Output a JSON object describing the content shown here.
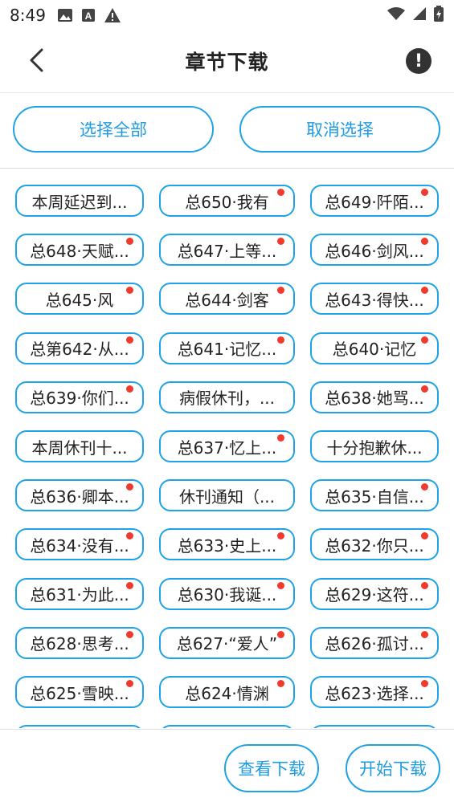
{
  "status_bar": {
    "time": "8:49"
  },
  "header": {
    "title": "章节下载"
  },
  "actions": {
    "select_all": "选择全部",
    "cancel_select": "取消选择"
  },
  "chapters": [
    {
      "label": "本周延迟到...",
      "new": false
    },
    {
      "label": "总650·我有",
      "new": true
    },
    {
      "label": "总649·阡陌...",
      "new": true
    },
    {
      "label": "总648·天赋...",
      "new": true
    },
    {
      "label": "总647·上等...",
      "new": true
    },
    {
      "label": "总646·剑风...",
      "new": true
    },
    {
      "label": "总645·风",
      "new": true
    },
    {
      "label": "总644·剑客",
      "new": true
    },
    {
      "label": "总643·得快...",
      "new": true
    },
    {
      "label": "总第642·从...",
      "new": true
    },
    {
      "label": "总641·记忆...",
      "new": true
    },
    {
      "label": "总640·记忆",
      "new": true
    },
    {
      "label": "总639·你们...",
      "new": true
    },
    {
      "label": "病假休刊，...",
      "new": false
    },
    {
      "label": "总638·她骂...",
      "new": true
    },
    {
      "label": "本周休刊十...",
      "new": false
    },
    {
      "label": "总637·忆上...",
      "new": true
    },
    {
      "label": "十分抱歉休...",
      "new": false
    },
    {
      "label": "总636·卿本...",
      "new": true
    },
    {
      "label": "休刊通知（...",
      "new": false
    },
    {
      "label": "总635·自信...",
      "new": true
    },
    {
      "label": "总634·没有...",
      "new": true
    },
    {
      "label": "总633·史上...",
      "new": true
    },
    {
      "label": "总632·你只...",
      "new": true
    },
    {
      "label": "总631·为此...",
      "new": true
    },
    {
      "label": "总630·我诞...",
      "new": true
    },
    {
      "label": "总629·这符...",
      "new": true
    },
    {
      "label": "总628·思考...",
      "new": true
    },
    {
      "label": "总627·“爱人”",
      "new": true
    },
    {
      "label": "总626·孤讨...",
      "new": true
    },
    {
      "label": "总625·雪映...",
      "new": true
    },
    {
      "label": "总624·情渊",
      "new": true
    },
    {
      "label": "总623·选择...",
      "new": true
    },
    {
      "label": "",
      "new": false
    },
    {
      "label": "",
      "new": false
    },
    {
      "label": "",
      "new": false
    }
  ],
  "footer": {
    "view_downloads": "查看下载",
    "start_download": "开始下载"
  },
  "colors": {
    "accent": "#1fa3e6",
    "new_dot": "#f03a2e"
  }
}
